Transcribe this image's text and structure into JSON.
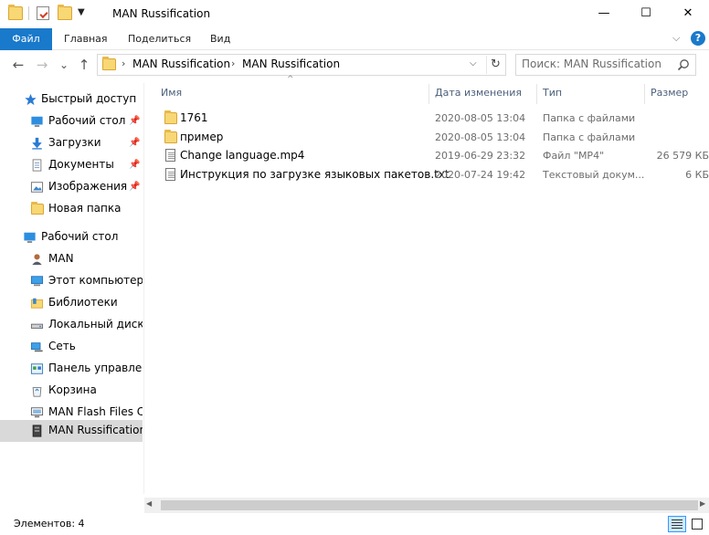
{
  "window": {
    "title": "MAN Russification",
    "minimize": "—",
    "maximize": "☐",
    "close": "✕"
  },
  "quick_access": {
    "dropdown": "▼"
  },
  "ribbon": {
    "tabs": [
      "Файл",
      "Главная",
      "Поделиться",
      "Вид"
    ],
    "collapse": "⌵",
    "help": "?"
  },
  "navigation": {
    "back": "←",
    "forward": "→",
    "recent": "⌄",
    "up": "↑"
  },
  "address": {
    "breadcrumbs": [
      "MAN Russification",
      "MAN Russification"
    ],
    "separator": "›",
    "dropdown": "⌵",
    "refresh": "↻"
  },
  "search": {
    "placeholder": "Поиск: MAN Russification"
  },
  "nav_pane": {
    "items": [
      {
        "label": "Быстрый доступ",
        "icon": "star-icon"
      },
      {
        "label": "Рабочий стол",
        "icon": "desktop-icon",
        "pinned": true
      },
      {
        "label": "Загрузки",
        "icon": "download-icon",
        "pinned": true
      },
      {
        "label": "Документы",
        "icon": "documents-icon",
        "pinned": true
      },
      {
        "label": "Изображения",
        "icon": "pictures-icon",
        "pinned": true
      },
      {
        "label": "Новая папка",
        "icon": "folder-icon"
      },
      {
        "label": "Рабочий стол",
        "icon": "desktop-icon"
      },
      {
        "label": "MAN",
        "icon": "user-icon"
      },
      {
        "label": "Этот компьютер",
        "icon": "computer-icon"
      },
      {
        "label": "Библиотеки",
        "icon": "libraries-icon"
      },
      {
        "label": "Локальный диск (E",
        "icon": "drive-icon"
      },
      {
        "label": "Сеть",
        "icon": "network-icon"
      },
      {
        "label": "Панель управлени",
        "icon": "control-panel-icon"
      },
      {
        "label": "Корзина",
        "icon": "recycle-bin-icon"
      },
      {
        "label": "MAN Flash Files Co",
        "icon": "flash-files-icon"
      },
      {
        "label": "MAN Russification",
        "icon": "archive-icon",
        "selected": true
      }
    ],
    "pin_glyph": "📌"
  },
  "columns": {
    "name": "Имя",
    "date": "Дата изменения",
    "type": "Тип",
    "size": "Размер",
    "sort_indicator": "^"
  },
  "files": [
    {
      "name": "1761",
      "date": "2020-08-05 13:04",
      "type": "Папка с файлами",
      "size": "",
      "icon": "folder-icon"
    },
    {
      "name": "пример",
      "date": "2020-08-05 13:04",
      "type": "Папка с файлами",
      "size": "",
      "icon": "folder-icon"
    },
    {
      "name": "Change language.mp4",
      "date": "2019-06-29 23:32",
      "type": "Файл \"MP4\"",
      "size": "26 579 КБ",
      "icon": "document-icon"
    },
    {
      "name": "Инструкция по загрузке языковых пакетов.txt",
      "date": "2020-07-24 19:42",
      "type": "Текстовый докум...",
      "size": "6 КБ",
      "icon": "text-file-icon"
    }
  ],
  "scrollbar": {
    "left": "◀",
    "right": "▶"
  },
  "status": {
    "count": "Элементов: 4"
  },
  "colors": {
    "accent": "#1979ca",
    "selected_nav": "#d9d9d9",
    "header_text": "#4c607a",
    "folder": "#f8d775"
  }
}
